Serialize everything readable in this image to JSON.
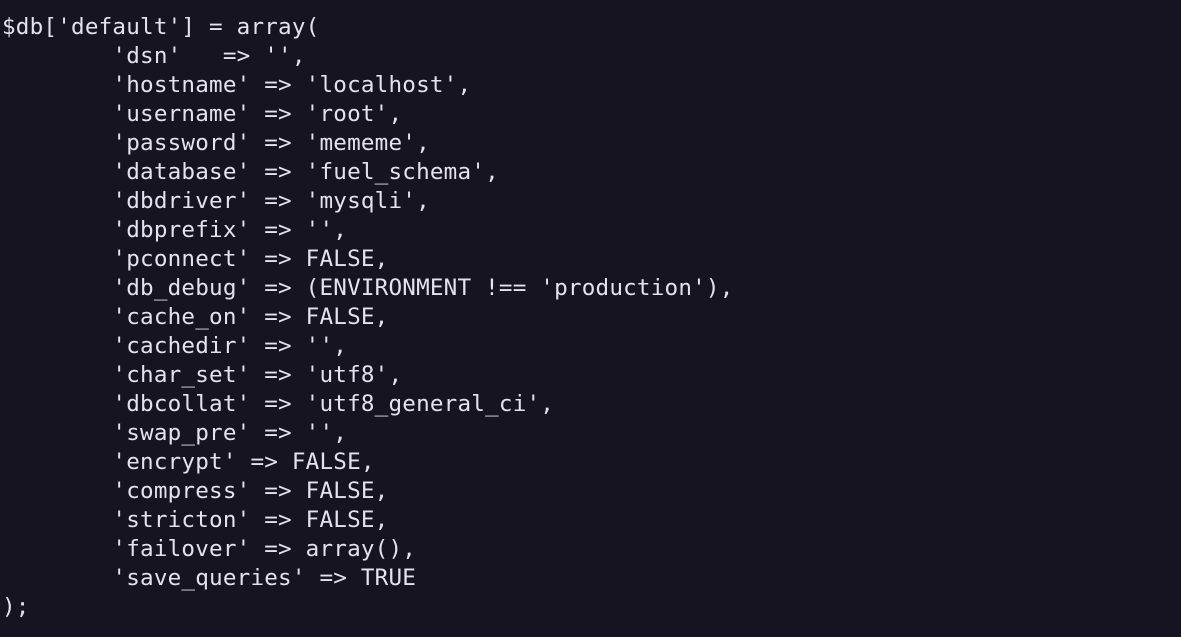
{
  "editor": {
    "background_color": "#161421",
    "text_color": "#e4e1f0",
    "lines": [
      "$db['default'] = array(",
      "        'dsn'   => '',",
      "        'hostname' => 'localhost',",
      "        'username' => 'root',",
      "        'password' => 'mememe',",
      "        'database' => 'fuel_schema',",
      "        'dbdriver' => 'mysqli',",
      "        'dbprefix' => '',",
      "        'pconnect' => FALSE,",
      "        'db_debug' => (ENVIRONMENT !== 'production'),",
      "        'cache_on' => FALSE,",
      "        'cachedir' => '',",
      "        'char_set' => 'utf8',",
      "        'dbcollat' => 'utf8_general_ci',",
      "        'swap_pre' => '',",
      "        'encrypt' => FALSE,",
      "        'compress' => FALSE,",
      "        'stricton' => FALSE,",
      "        'failover' => array(),",
      "        'save_queries' => TRUE",
      ");"
    ]
  }
}
